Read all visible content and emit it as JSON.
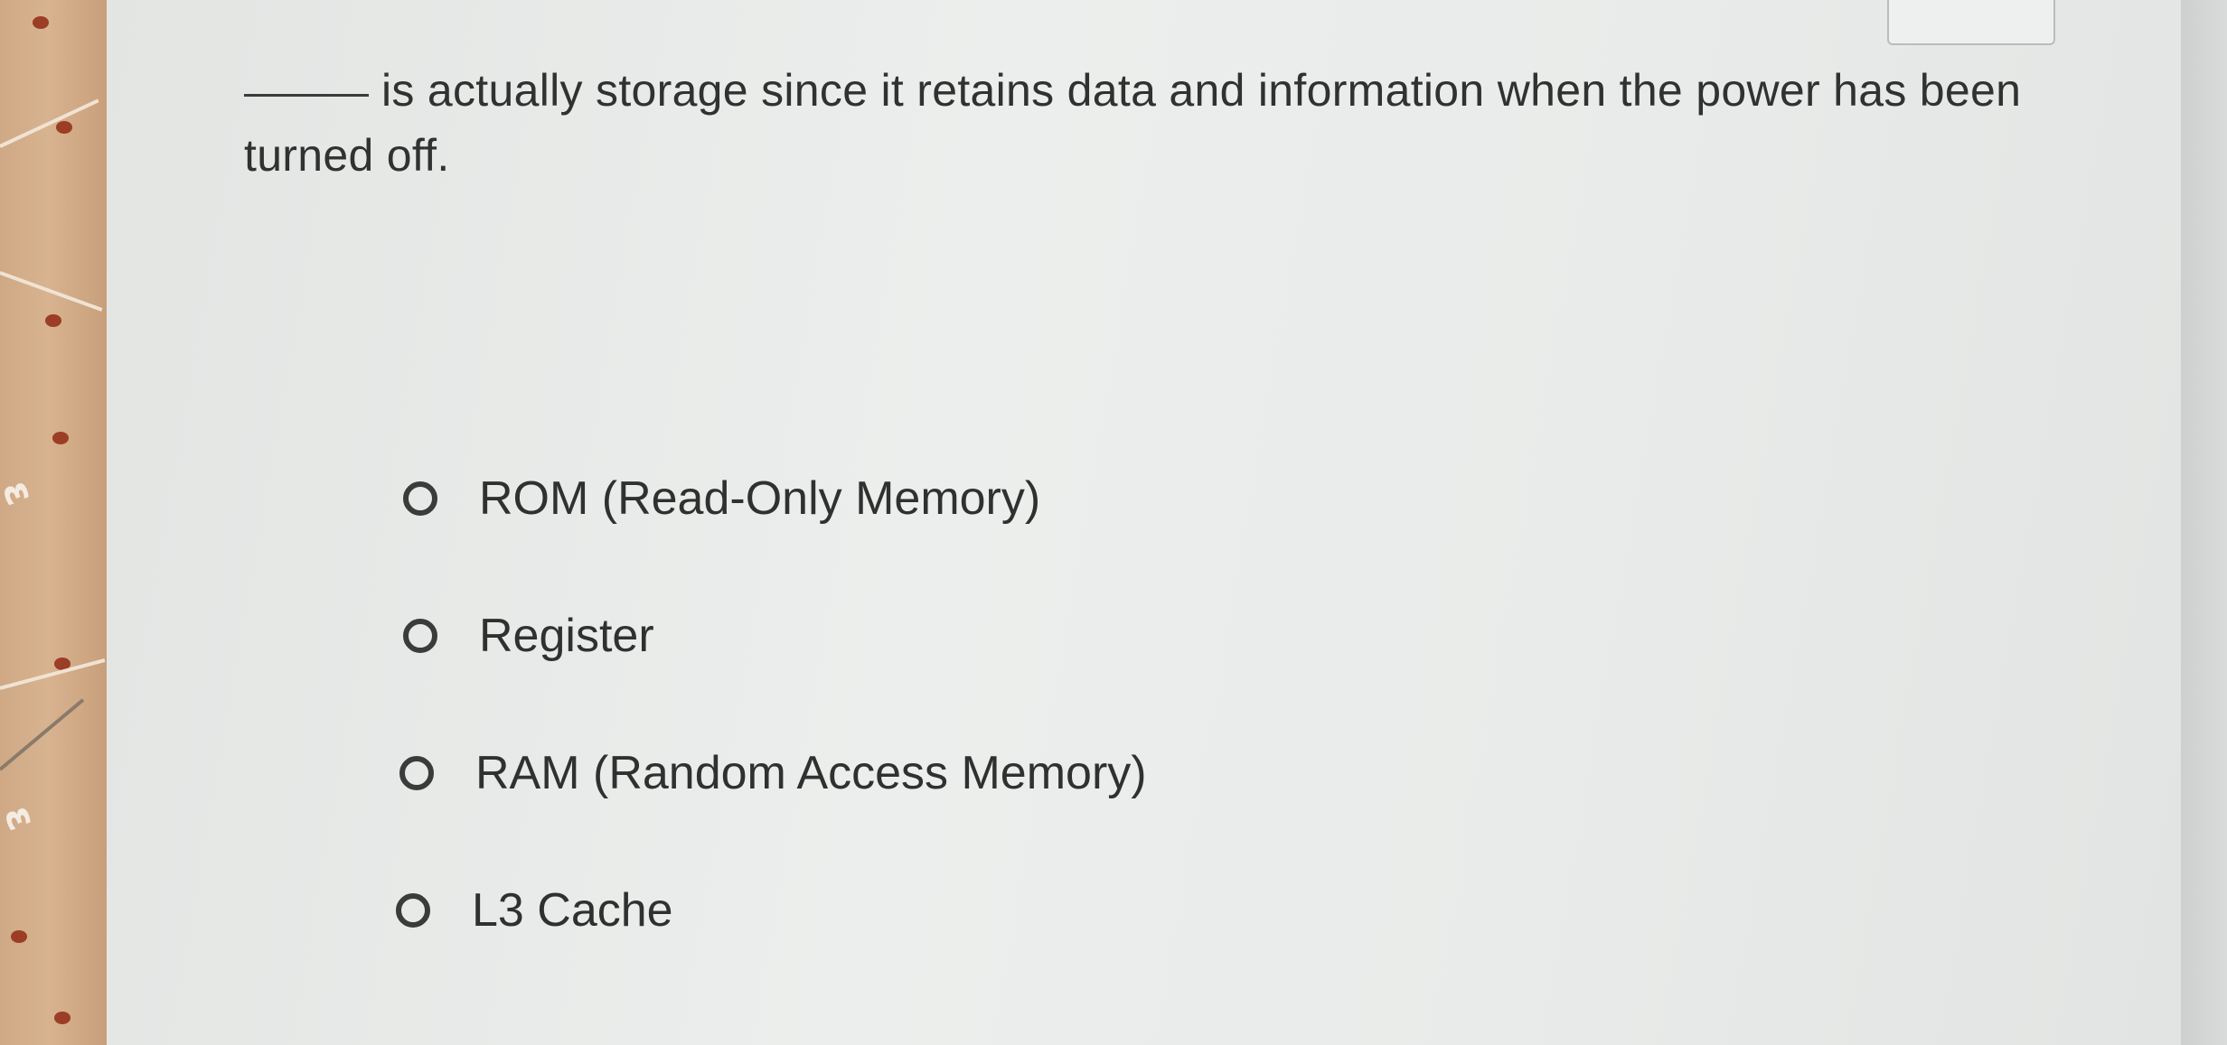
{
  "question": {
    "text": "is actually storage since it retains data and information when the power has been turned off."
  },
  "options": [
    {
      "label": "ROM (Read-Only Memory)",
      "selected": false
    },
    {
      "label": "Register",
      "selected": false
    },
    {
      "label": "RAM (Random Access Memory)",
      "selected": false
    },
    {
      "label": "L3 Cache",
      "selected": false
    }
  ]
}
